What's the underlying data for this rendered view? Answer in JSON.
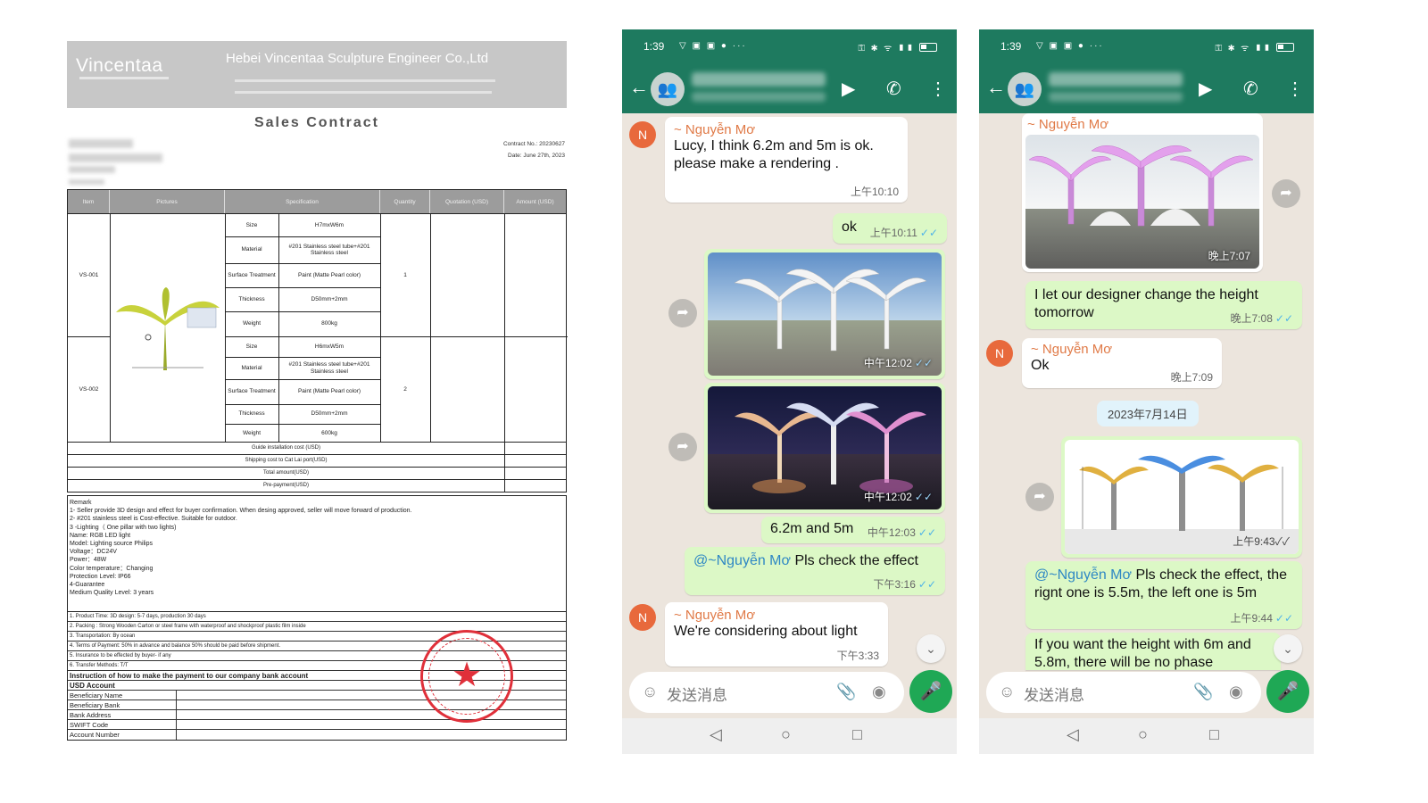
{
  "contract": {
    "logo": "Vincentaa",
    "company": "Hebei Vincentaa Sculpture Engineer Co.,Ltd",
    "title": "Sales Contract",
    "contract_no": "Contract No.: 20230627",
    "date": "Date: June 27th, 2023",
    "headers": [
      "Item",
      "Pictures",
      "Specification",
      "Quantity",
      "Quotation (USD)",
      "Amount (USD)"
    ],
    "items": [
      {
        "code": "VS-001",
        "qty": "1",
        "specs": [
          [
            "Size",
            "H7mxW6m"
          ],
          [
            "Material",
            "#201 Stainless steel tube+#201 Stainless steel"
          ],
          [
            "Surface Treatment",
            "Paint (Matte Pearl color)"
          ],
          [
            "Thickness",
            "D50mm+2mm"
          ],
          [
            "Weight",
            "800kg"
          ]
        ]
      },
      {
        "code": "VS-002",
        "qty": "2",
        "specs": [
          [
            "Size",
            "H6mxW5m"
          ],
          [
            "Material",
            "#201 Stainless steel tube+#201 Stainless steel"
          ],
          [
            "Surface Treatment",
            "Paint (Matte Pearl color)"
          ],
          [
            "Thickness",
            "D50mm+2mm"
          ],
          [
            "Weight",
            "600kg"
          ]
        ]
      }
    ],
    "totals": [
      "Guide installation cost (USD)",
      "Shipping cost to Cat Lai port(USD)",
      "Total amount(USD)",
      "Pre-payment(USD)"
    ],
    "remark": [
      "Remark",
      "1- Seller provide 3D design and effect for buyer confirmation. When desing approved, seller will move forward of production.",
      "2- #201 stainless steel is Cost-effective.  Suitable for outdoor.",
      "3 -Lighting（ One pillar with two  lights)",
      "Name: RGB LED light",
      "Model:  Lighting source Philips",
      "Voltage：DC24V",
      "Power：48W",
      "Color temperature：Changing",
      "Protection Level: IP66",
      "4-Guarantee",
      "Medium Quality Level: 3 years"
    ],
    "terms": [
      "1. Product Time:  3D design: 5-7 days, production 30 days",
      "2. Packing : Strong Wooden Carton or steel frame with waterproof and shockproof plastic film inside",
      "3. Transportation: By ocean",
      "4. Terms of Payment: 50%  in advance and balance 50% should be paid before shipment.",
      "5. Insurance to be effected by buyer- if any",
      "6. Transfer Methods: T/T"
    ],
    "bank_title": "Instruction of how to make the payment to our company bank account",
    "usd_account": "USD Account",
    "bank_fields": [
      "Beneficiary Name",
      "Beneficiary Bank",
      "Bank Address",
      "SWIFT Code",
      "Account Number"
    ]
  },
  "phone_common": {
    "status_time": "1:39",
    "input_placeholder": "发送消息",
    "sender": "~ Nguyễn Mơ",
    "avatar_letter": "N"
  },
  "phone1": {
    "messages": {
      "m1_text": "Lucy, I think 6.2m and 5m is ok. please make a rendering .",
      "m1_time": "上午10:10",
      "m2_text": "ok",
      "m2_time": "上午10:11",
      "img1_time": "中午12:02",
      "img2_time": "中午12:02",
      "m3_text": "6.2m and 5m",
      "m3_time": "中午12:03",
      "m4_mention": "@~Nguyễn Mơ",
      "m4_text": " Pls check the effect",
      "m4_time": "下午3:16",
      "m5_text": "We're considering about light",
      "m5_time": "下午3:33"
    }
  },
  "phone2": {
    "messages": {
      "img1_time": "晚上7:07",
      "m1_text": "I let our designer change the height tomorrow",
      "m1_time": "晚上7:08",
      "m2_text": "Ok",
      "m2_time": "晚上7:09",
      "date_chip": "2023年7月14日",
      "img2_time": "上午9:43",
      "m3_mention": "@~Nguyễn Mơ",
      "m3_text": " Pls check the effect, the rignt one is 5.5m, the left one is 5m",
      "m3_time": "上午9:44",
      "m4_text": "If you want the height with 6m and 5.8m, there will be no phase"
    }
  },
  "colors": {
    "whatsapp_green": "#1e7a5f",
    "outgoing_bubble": "#dcf8c6",
    "seal_red": "#e0303a"
  }
}
